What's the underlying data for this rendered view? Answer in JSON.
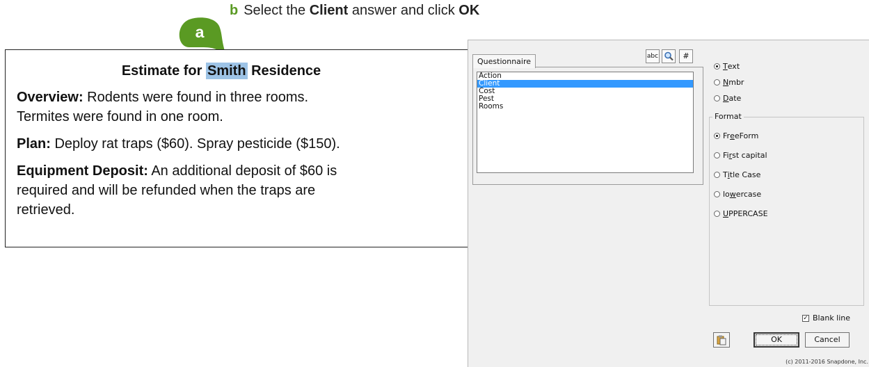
{
  "instruction": {
    "step": "b",
    "pre": "Select the ",
    "bold1": "Client",
    "mid": " answer and click ",
    "bold2": "OK"
  },
  "callouts": {
    "a": "a",
    "b": "b"
  },
  "colors": {
    "callout_green": "#5a9a23",
    "selection_blue": "#3399ff",
    "highlight": "#9dc3e6"
  },
  "document": {
    "title_pre": "Estimate for ",
    "title_highlight": "Smith",
    "title_post": " Residence",
    "overview_label": "Overview:",
    "overview_line1": " Rodents were found in three rooms.",
    "overview_line2": "Termites were found in one room.",
    "plan_label": "Plan:",
    "plan_text": " Deploy rat traps ($60). Spray pesticide ($150).",
    "deposit_label": "Equipment Deposit:",
    "deposit_line1": " An additional deposit of $60 is",
    "deposit_line2": "required and will be refunded when the traps are",
    "deposit_line3": "retrieved."
  },
  "dialog": {
    "tab_label": "Questionnaire",
    "tools": {
      "abc": "abc",
      "search": "search-icon",
      "number": "#"
    },
    "list_items": [
      "Action",
      "Client",
      "Cost",
      "Pest",
      "Rooms"
    ],
    "selected_item": "Client",
    "type_options": [
      {
        "pre": "",
        "u": "T",
        "post": "ext",
        "checked": true
      },
      {
        "pre": "",
        "u": "N",
        "post": "mbr",
        "checked": false
      },
      {
        "pre": "",
        "u": "D",
        "post": "ate",
        "checked": false
      }
    ],
    "format_label": "Format",
    "format_options": [
      {
        "pre": "Fr",
        "u": "e",
        "post": "eForm",
        "checked": true
      },
      {
        "pre": "Fi",
        "u": "r",
        "post": "st capital",
        "checked": false
      },
      {
        "pre": "T",
        "u": "i",
        "post": "tle Case",
        "checked": false
      },
      {
        "pre": "lo",
        "u": "w",
        "post": "ercase",
        "checked": false
      },
      {
        "pre": "",
        "u": "U",
        "post": "PPERCASE",
        "checked": false
      }
    ],
    "blank_line_label": "Blank line",
    "blank_line_checked": true,
    "ok_label": "OK",
    "cancel_label": "Cancel",
    "copyright": "(c) 2011-2016 Snapdone, Inc."
  }
}
